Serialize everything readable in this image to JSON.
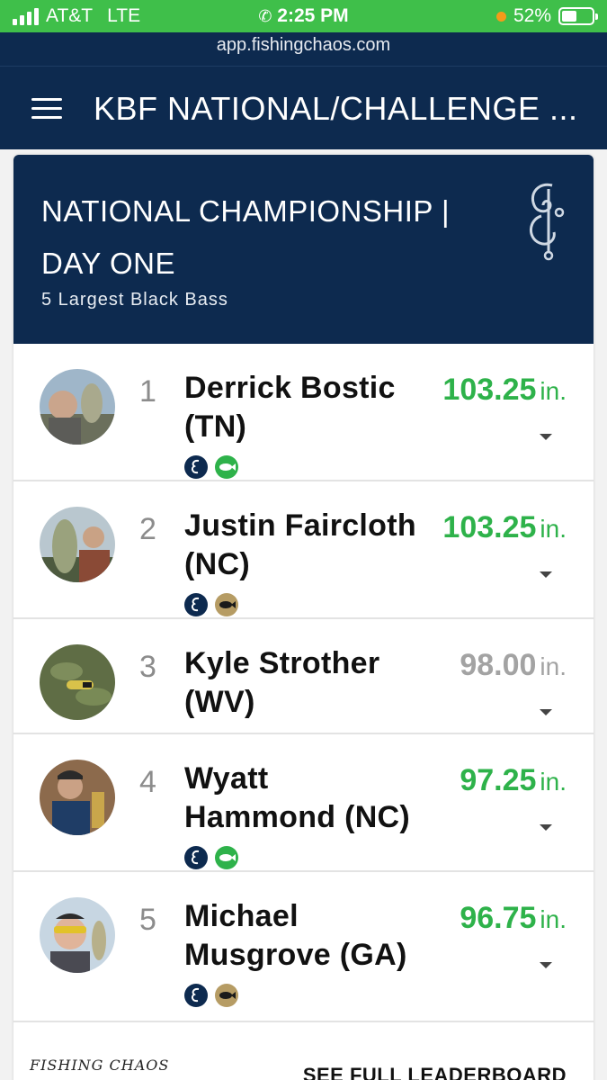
{
  "status_bar": {
    "carrier": "AT&T",
    "network": "LTE",
    "time": "2:25 PM",
    "battery": "52%",
    "battery_level": 0.52
  },
  "url": "app.fishingchaos.com",
  "header": {
    "title": "KBF NATIONAL/CHALLENGE ..."
  },
  "event": {
    "title": "NATIONAL CHAMPIONSHIP | DAY ONE",
    "subtitle": "5 Largest Black Bass"
  },
  "leaderboard": [
    {
      "rank": "1",
      "name": "Derrick Bostic (TN)",
      "score": "103.25",
      "unit": "in.",
      "score_color": "green",
      "badges": [
        "chaos-badge-icon",
        "kbf-green-badge-icon"
      ]
    },
    {
      "rank": "2",
      "name": "Justin Faircloth (NC)",
      "score": "103.25",
      "unit": "in.",
      "score_color": "green",
      "badges": [
        "chaos-badge-icon",
        "kbf-gold-badge-icon"
      ]
    },
    {
      "rank": "3",
      "name": "Kyle Strother (WV)",
      "score": "98.00",
      "unit": "in.",
      "score_color": "gray",
      "badges": []
    },
    {
      "rank": "4",
      "name": "Wyatt Hammond (NC)",
      "score": "97.25",
      "unit": "in.",
      "score_color": "green",
      "badges": [
        "chaos-badge-icon",
        "kbf-green-badge-icon"
      ]
    },
    {
      "rank": "5",
      "name": "Michael Musgrove (GA)",
      "score": "96.75",
      "unit": "in.",
      "score_color": "green",
      "badges": [
        "chaos-badge-icon",
        "kbf-gold-badge-icon"
      ]
    }
  ],
  "footer": {
    "logo": "FISHING CHAOS",
    "link": "SEE FULL LEADERBOARD"
  },
  "colors": {
    "navy": "#0d2a4f",
    "green": "#2eb24a",
    "status_green": "#3fbf4a",
    "gray_score": "#a3a3a3",
    "gold": "#b69c64"
  }
}
